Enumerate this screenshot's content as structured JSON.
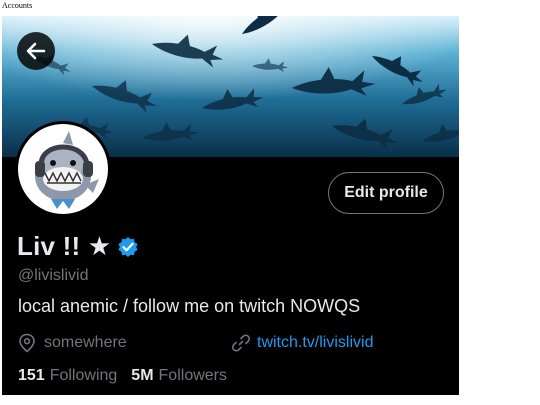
{
  "page": {
    "note": "Accounts"
  },
  "header": {
    "back_icon": "arrow-left-icon"
  },
  "profile": {
    "display_name": "Liv !! ★",
    "verified_icon": "verified-badge-icon",
    "verified_color": "#1d9bf0",
    "handle": "@livislivid",
    "bio": "local anemic / follow me on twitch NOWQS",
    "location": "somewhere",
    "location_icon": "location-pin-icon",
    "link": "twitch.tv/livislivid",
    "link_icon": "link-icon",
    "edit_button": "Edit profile"
  },
  "stats": {
    "following_count": "151",
    "following_label": "Following",
    "followers_count": "5M",
    "followers_label": "Followers"
  },
  "colors": {
    "background": "#000000",
    "text": "#e7e9ea",
    "muted": "#71767b",
    "accent": "#1d9bf0"
  }
}
